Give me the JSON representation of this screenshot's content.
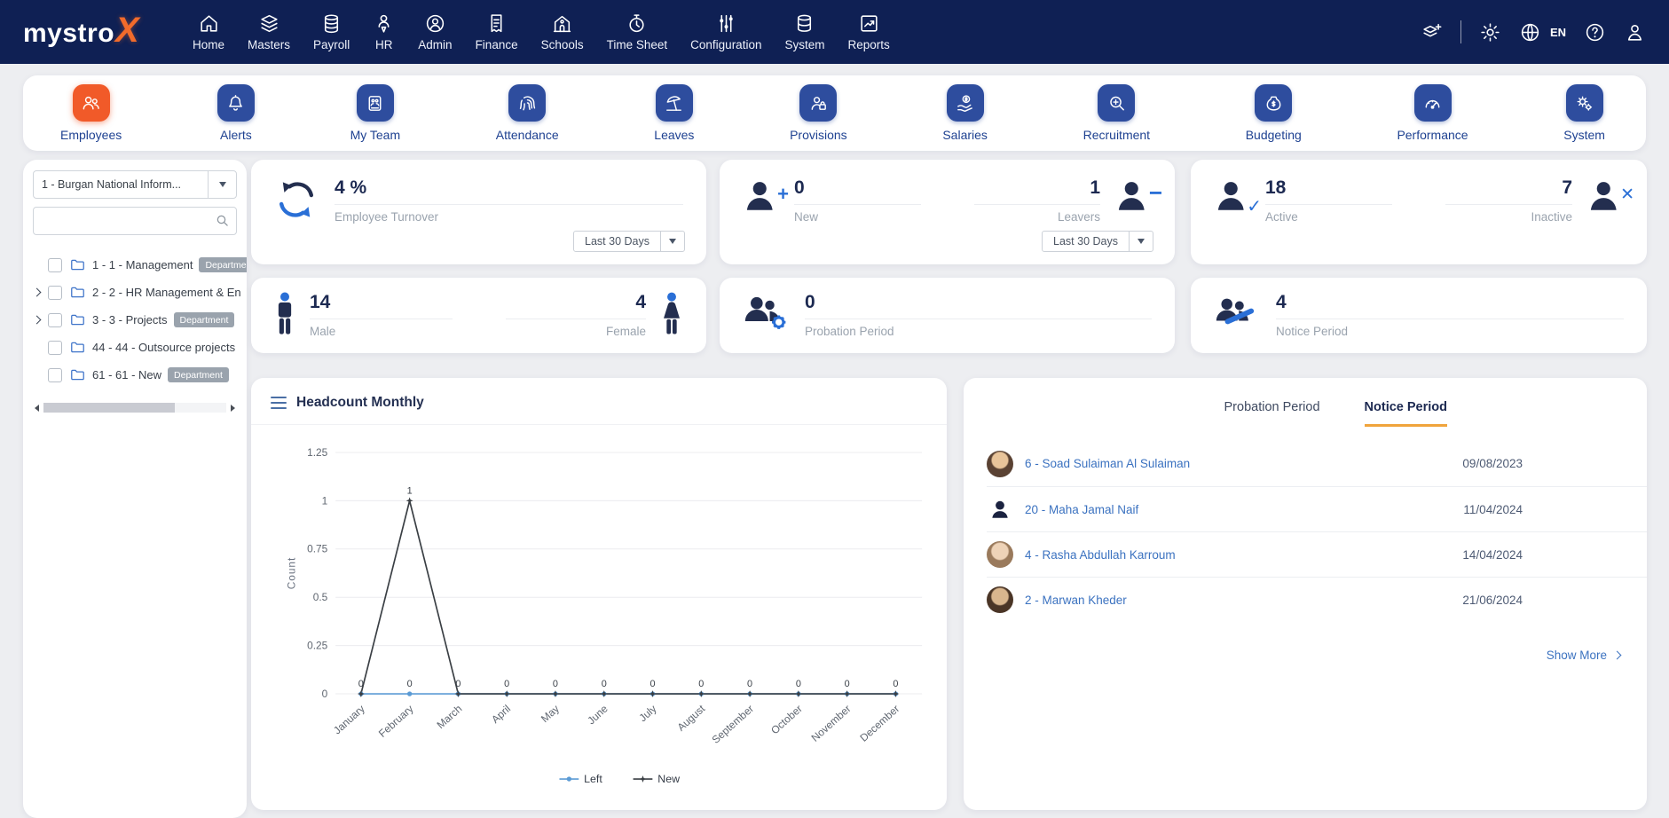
{
  "brand": {
    "name": "mystro",
    "x": "X"
  },
  "navbar": {
    "items": [
      {
        "label": "Home",
        "icon": "home-icon"
      },
      {
        "label": "Masters",
        "icon": "layers-icon"
      },
      {
        "label": "Payroll",
        "icon": "coins-icon"
      },
      {
        "label": "HR",
        "icon": "person-pin-icon"
      },
      {
        "label": "Admin",
        "icon": "person-circle-icon"
      },
      {
        "label": "Finance",
        "icon": "receipt-icon"
      },
      {
        "label": "Schools",
        "icon": "school-icon"
      },
      {
        "label": "Time Sheet",
        "icon": "stopwatch-icon"
      },
      {
        "label": "Configuration",
        "icon": "sliders-icon"
      },
      {
        "label": "System",
        "icon": "database-icon"
      },
      {
        "label": "Reports",
        "icon": "report-chart-icon"
      }
    ],
    "language": "EN",
    "right_icons": [
      "layers-plus-icon",
      "gear-icon",
      "globe-icon",
      "help-icon",
      "user-icon"
    ]
  },
  "modules": {
    "items": [
      {
        "label": "Employees",
        "icon": "employees-icon",
        "active": true
      },
      {
        "label": "Alerts",
        "icon": "bell-icon",
        "active": false
      },
      {
        "label": "My Team",
        "icon": "team-icon",
        "active": false
      },
      {
        "label": "Attendance",
        "icon": "fingerprint-icon",
        "active": false
      },
      {
        "label": "Leaves",
        "icon": "beach-umbrella-icon",
        "active": false
      },
      {
        "label": "Provisions",
        "icon": "person-lock-icon",
        "active": false
      },
      {
        "label": "Salaries",
        "icon": "hand-coin-icon",
        "active": false
      },
      {
        "label": "Recruitment",
        "icon": "magnifier-plus-icon",
        "active": false
      },
      {
        "label": "Budgeting",
        "icon": "money-bag-icon",
        "active": false
      },
      {
        "label": "Performance",
        "icon": "gauge-icon",
        "active": false
      },
      {
        "label": "System",
        "icon": "gears-icon",
        "active": false
      }
    ]
  },
  "sidebar": {
    "company_select": "1 - Burgan National Inform...",
    "tree": [
      {
        "label": "1 - 1 - Management",
        "badge": "Department",
        "expandable": false
      },
      {
        "label": "2 - 2 - HR Management & En",
        "badge": "",
        "expandable": true
      },
      {
        "label": "3 - 3 - Projects",
        "badge": "Department",
        "expandable": true
      },
      {
        "label": "44 - 44 - Outsource projects",
        "badge": "",
        "expandable": false
      },
      {
        "label": "61 - 61 - New",
        "badge": "Department",
        "expandable": false
      }
    ]
  },
  "stats": {
    "turnover": {
      "value": "4 %",
      "label": "Employee Turnover",
      "period": "Last 30 Days"
    },
    "new": {
      "value": "0",
      "label": "New"
    },
    "leavers": {
      "value": "1",
      "label": "Leavers",
      "period": "Last 30 Days"
    },
    "active": {
      "value": "18",
      "label": "Active"
    },
    "inactive": {
      "value": "7",
      "label": "Inactive"
    },
    "male": {
      "value": "14",
      "label": "Male"
    },
    "female": {
      "value": "4",
      "label": "Female"
    },
    "probation": {
      "value": "0",
      "label": "Probation Period"
    },
    "notice": {
      "value": "4",
      "label": "Notice Period"
    }
  },
  "chart_card": {
    "title": "Headcount Monthly"
  },
  "chart_data": {
    "type": "line",
    "title": "Headcount Monthly",
    "xlabel": "",
    "ylabel": "Count",
    "x": [
      "January",
      "February",
      "March",
      "April",
      "May",
      "June",
      "July",
      "August",
      "September",
      "October",
      "November",
      "December"
    ],
    "series": [
      {
        "name": "Left",
        "color": "#5b9bd5",
        "marker": "circle",
        "values": [
          0,
          0,
          0,
          0,
          0,
          0,
          0,
          0,
          0,
          0,
          0,
          0
        ]
      },
      {
        "name": "New",
        "color": "#3a3f44",
        "marker": "star",
        "values": [
          0,
          1,
          0,
          0,
          0,
          0,
          0,
          0,
          0,
          0,
          0,
          0
        ]
      }
    ],
    "ylim": [
      0,
      1.25
    ],
    "yticks": [
      0,
      0.25,
      0.5,
      0.75,
      1,
      1.25
    ],
    "grid": true,
    "legend_position": "bottom"
  },
  "panel": {
    "tabs": [
      {
        "label": "Probation Period",
        "active": false
      },
      {
        "label": "Notice Period",
        "active": true
      }
    ],
    "rows": [
      {
        "name": "6 - Soad Sulaiman Al Sulaiman",
        "date": "09/08/2023"
      },
      {
        "name": "20 - Maha Jamal Naif",
        "date": "11/04/2024"
      },
      {
        "name": "4 - Rasha Abdullah Karroum",
        "date": "14/04/2024"
      },
      {
        "name": "2 - Marwan Kheder",
        "date": "21/06/2024"
      }
    ],
    "show_more": "Show More"
  },
  "colors": {
    "navbar_bg": "#0f2054",
    "brand_orange": "#f26b2b",
    "tile_blue": "#2e4d9e",
    "active_tile_orange": "#f15a29",
    "module_label_blue": "#1e4191",
    "value_navy": "#1c2951",
    "link_blue": "#3b72c0",
    "icon_accent_blue": "#2a6fd6",
    "tab_underline_orange": "#f0a43c",
    "series_left": "#5b9bd5",
    "series_new": "#3a3f44"
  }
}
